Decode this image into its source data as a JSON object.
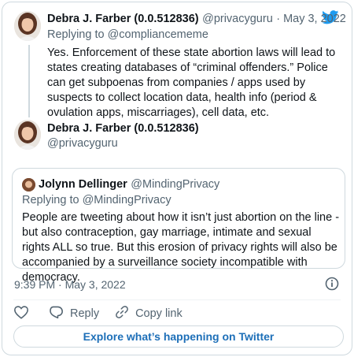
{
  "brand": {
    "logo_color": "#1d9bf0"
  },
  "reply_tweet": {
    "author_name": "Debra J. Farber (0.0.512836)",
    "author_handle": "@privacyguru",
    "date": "· May 3, 2022",
    "replying_prefix": "Replying to",
    "replying_handle": "@compliancememe",
    "text": "Yes. Enforcement of these state abortion laws will lead to states creating databases of “criminal offenders.” Police can get subpoenas from companies / apps used by suspects to collect location data, health info (period & ovulation apps, miscarriages), cell data, etc."
  },
  "main_tweet": {
    "author_name": "Debra J. Farber (0.0.512836)",
    "author_handle": "@privacyguru",
    "quoted": {
      "author_name": "Jolynn Dellinger",
      "author_handle": "@MindingPrivacy",
      "replying_prefix": "Replying to",
      "replying_handle": "@MindingPrivacy",
      "text": "People are tweeting about how it isn’t just abortion on the line - but also contraception, gay marriage, intimate and sexual rights ALL so true. But this erosion of privacy rights will also be accompanied by a surveillance society incompatible with democracy."
    },
    "timestamp": "9:39 PM · May 3, 2022"
  },
  "actions": {
    "like_icon": "heart-icon",
    "reply_label": "Reply",
    "copy_link_label": "Copy link"
  },
  "explore_label": "Explore what’s happening on Twitter"
}
